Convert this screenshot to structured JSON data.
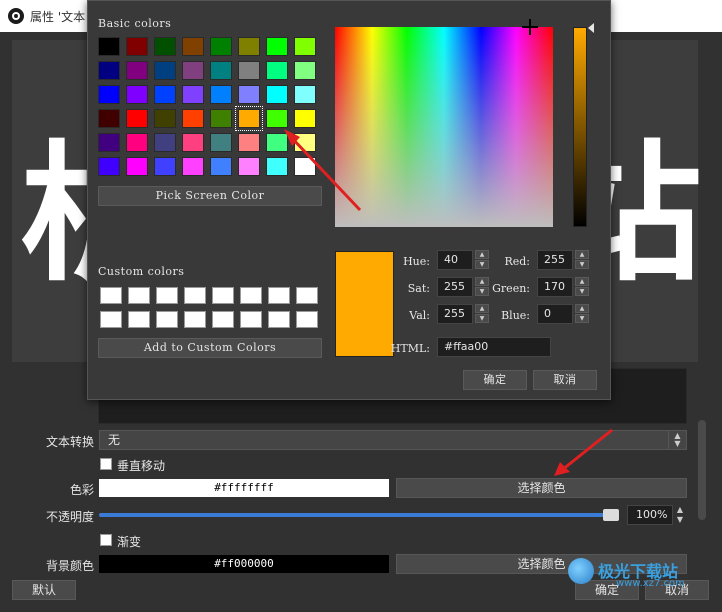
{
  "window": {
    "title": "属性 '文本"
  },
  "preview": {
    "text_left": "析",
    "text_right": "站"
  },
  "properties": {
    "text_transform_label": "文本转换",
    "text_transform_value": "无",
    "vertical_label": "垂直移动",
    "color_label": "色彩",
    "color_value": "#ffffffff",
    "pick_color_button": "选择颜色",
    "opacity_label": "不透明度",
    "opacity_value": "100%",
    "opacity_percent": 100,
    "gradient_label": "渐变",
    "bg_color_label": "背景颜色",
    "bg_color_value": "#ff000000",
    "bg_pick_color_button": "选择颜色",
    "defaults_button": "默认",
    "ok_button": "确定",
    "cancel_button": "取消"
  },
  "watermark": {
    "text": "极光下载站",
    "sub": "www.xz7.com"
  },
  "color_dialog": {
    "basic_colors_label": "Basic colors",
    "basic_colors": [
      [
        "#000000",
        "#800000",
        "#005000",
        "#804000",
        "#008000",
        "#808000",
        "#00ff00",
        "#80ff00"
      ],
      [
        "#000080",
        "#800080",
        "#004080",
        "#804080",
        "#008080",
        "#808080",
        "#00ff80",
        "#80ff80"
      ],
      [
        "#0000ff",
        "#8000ff",
        "#0040ff",
        "#8040ff",
        "#0080ff",
        "#8080ff",
        "#00ffff",
        "#80ffff"
      ],
      [
        "#400000",
        "#ff0000",
        "#404000",
        "#ff4000",
        "#408000",
        "#ffaa00",
        "#40ff00",
        "#ffff00"
      ],
      [
        "#400080",
        "#ff0080",
        "#404080",
        "#ff4080",
        "#408080",
        "#ff8080",
        "#40ff80",
        "#ffff80"
      ],
      [
        "#4000ff",
        "#ff00ff",
        "#4040ff",
        "#ff40ff",
        "#4080ff",
        "#ff80ff",
        "#40ffff",
        "#ffffff"
      ]
    ],
    "selected_cell": [
      3,
      5
    ],
    "pick_screen_color": "Pick Screen Color",
    "custom_colors_label": "Custom colors",
    "add_custom_colors": "Add to Custom Colors",
    "fields": {
      "hue_label": "Hue:",
      "hue": "40",
      "sat_label": "Sat:",
      "sat": "255",
      "val_label": "Val:",
      "val": "255",
      "red_label": "Red:",
      "red": "255",
      "green_label": "Green:",
      "green": "170",
      "blue_label": "Blue:",
      "blue": "0",
      "html_label": "HTML:",
      "html": "#ffaa00"
    },
    "current_color": "#ffaa00",
    "ok_button": "确定",
    "cancel_button": "取消"
  },
  "colors": {
    "accent": "#3a7bd5",
    "annotation_arrow": "#e02020"
  }
}
